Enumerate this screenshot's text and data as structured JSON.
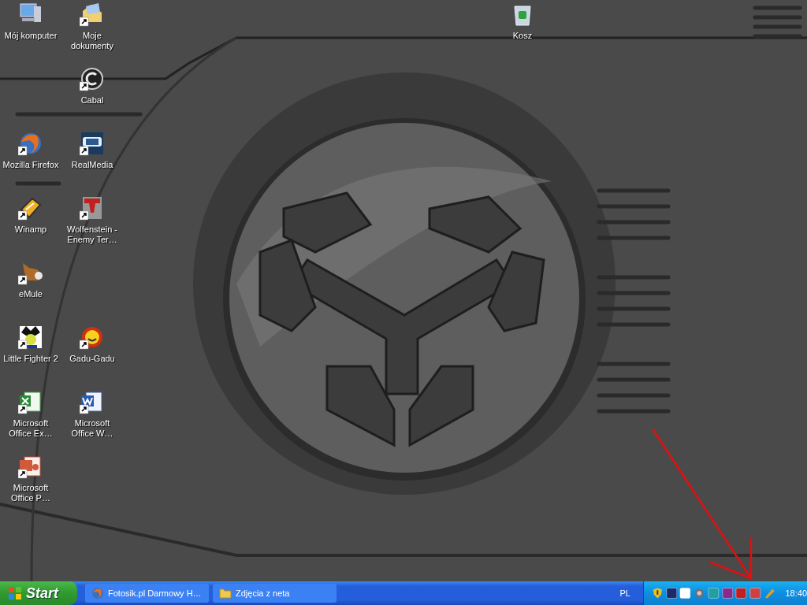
{
  "desktop_icons": [
    {
      "label": "Mój komputer",
      "shortcut": false
    },
    {
      "label": "Moje dokumenty",
      "shortcut": true
    },
    {
      "label": "Cabal",
      "shortcut": true
    },
    {
      "label": "Mozilla Firefox",
      "shortcut": true
    },
    {
      "label": "RealMedia",
      "shortcut": true
    },
    {
      "label": "Winamp",
      "shortcut": true
    },
    {
      "label": "Wolfenstein - Enemy Ter…",
      "shortcut": true
    },
    {
      "label": "eMule",
      "shortcut": true
    },
    {
      "label": "Little Fighter 2",
      "shortcut": true
    },
    {
      "label": "Gadu-Gadu",
      "shortcut": true
    },
    {
      "label": "Microsoft Office Ex…",
      "shortcut": true
    },
    {
      "label": "Microsoft Office W…",
      "shortcut": true
    },
    {
      "label": "Microsoft Office P…",
      "shortcut": true
    },
    {
      "label": "Kosz",
      "shortcut": false
    }
  ],
  "taskbar": {
    "start": "Start",
    "tasks": [
      {
        "label": "Fotosik.pl Darmowy H…",
        "selected": false
      },
      {
        "label": "Zdjęcia z neta",
        "selected": false
      }
    ],
    "language": "PL",
    "clock": "18:40"
  }
}
